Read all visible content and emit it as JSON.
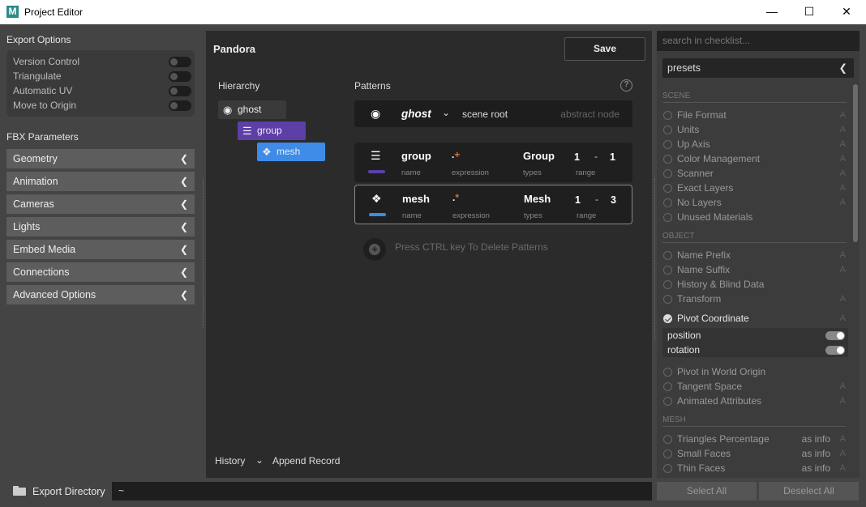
{
  "window": {
    "title": "Project Editor",
    "logo": "M",
    "controls": [
      "—",
      "☐",
      "✕"
    ]
  },
  "left": {
    "export_title": "Export Options",
    "export_options": [
      {
        "label": "Version Control",
        "on": false
      },
      {
        "label": "Triangulate",
        "on": false
      },
      {
        "label": "Automatic UV",
        "on": false
      },
      {
        "label": "Move to Origin",
        "on": false
      }
    ],
    "fbx_title": "FBX Parameters",
    "fbx_items": [
      "Geometry",
      "Animation",
      "Cameras",
      "Lights",
      "Embed Media",
      "Connections",
      "Advanced Options"
    ]
  },
  "center": {
    "title": "Pandora",
    "save_label": "Save",
    "hierarchy_label": "Hierarchy",
    "patterns_label": "Patterns",
    "hierarchy": [
      {
        "label": "ghost",
        "icon": "ghost-icon",
        "color": "#3a3a3a"
      },
      {
        "label": "group",
        "icon": "layers-icon",
        "color": "#5d3fa8"
      },
      {
        "label": "mesh",
        "icon": "mesh-icon",
        "color": "#3e8be8"
      }
    ],
    "root": {
      "name": "ghost",
      "role": "scene root",
      "kind": "abstract node"
    },
    "patterns": [
      {
        "name": "group",
        "expr_main": ".",
        "expr_acc": "+",
        "type": "Group",
        "min": "1",
        "max": "1",
        "color": "#5d3fa8",
        "name_sub": "name",
        "expr_sub": "expression",
        "types_sub": "types",
        "range_sub": "range"
      },
      {
        "name": "mesh",
        "expr_main": ".",
        "expr_acc": "*",
        "type": "Mesh",
        "min": "1",
        "max": "3",
        "color": "#3e8be8",
        "name_sub": "name",
        "expr_sub": "expression",
        "types_sub": "types",
        "range_sub": "range"
      }
    ],
    "range_dash": "-",
    "add_hint": "Press CTRL key To Delete Patterns",
    "history_label": "History",
    "append_label": "Append Record"
  },
  "right": {
    "search_placeholder": "search in checklist...",
    "presets": "presets",
    "scene_cat": "SCENE",
    "scene_items": [
      {
        "label": "File Format",
        "a": "A"
      },
      {
        "label": "Units",
        "a": "A"
      },
      {
        "label": "Up Axis",
        "a": "A"
      },
      {
        "label": "Color Management",
        "a": "A"
      },
      {
        "label": "Scanner",
        "a": "A"
      },
      {
        "label": "Exact Layers",
        "a": "A"
      },
      {
        "label": "No Layers",
        "a": "A"
      },
      {
        "label": "Unused Materials",
        "a": ""
      }
    ],
    "object_cat": "OBJECT",
    "object_items": [
      {
        "label": "Name Prefix",
        "a": "A"
      },
      {
        "label": "Name Suffix",
        "a": "A"
      },
      {
        "label": "History & Blind Data",
        "a": ""
      },
      {
        "label": "Transform",
        "a": "A"
      }
    ],
    "pivot": {
      "label": "Pivot Coordinate",
      "a": "A",
      "checked": true
    },
    "pivot_sub": [
      {
        "label": "position",
        "on": true
      },
      {
        "label": "rotation",
        "on": true
      }
    ],
    "object_items2": [
      {
        "label": "Pivot in World Origin",
        "a": ""
      },
      {
        "label": "Tangent Space",
        "a": "A"
      },
      {
        "label": "Animated Attributes",
        "a": "A"
      }
    ],
    "mesh_cat": "MESH",
    "mesh_items": [
      {
        "label": "Triangles Percentage",
        "info": "as info",
        "a": "A"
      },
      {
        "label": "Small Faces",
        "info": "as info",
        "a": "A"
      },
      {
        "label": "Thin Faces",
        "info": "as info",
        "a": "A"
      }
    ]
  },
  "bottom": {
    "export_dir_label": "Export Directory",
    "export_dir_value": "~",
    "select_all": "Select All",
    "deselect_all": "Deselect All"
  }
}
